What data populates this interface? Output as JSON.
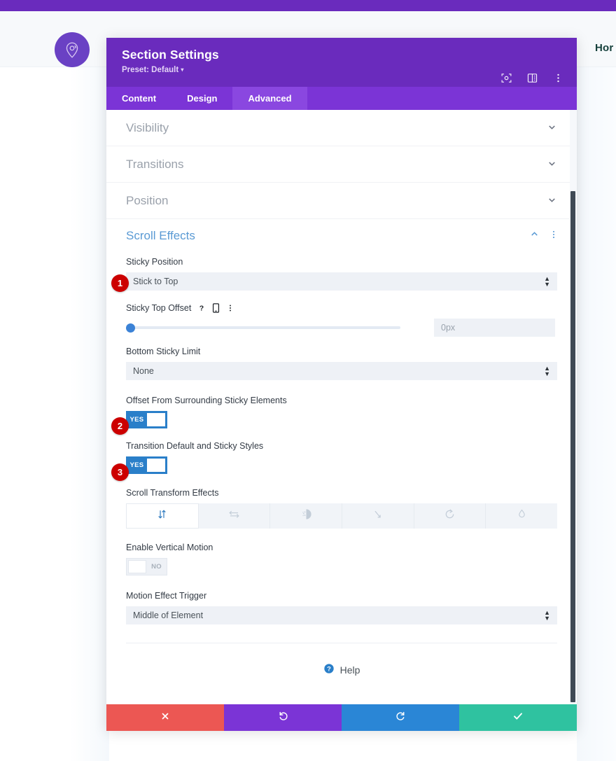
{
  "page": {
    "logo_icon": "map-pin-icon",
    "nav_item_truncated": "Hor"
  },
  "modal": {
    "title": "Section Settings",
    "preset": "Preset: Default",
    "preset_caret": "▾",
    "header_icons": [
      {
        "name": "focus-target-icon"
      },
      {
        "name": "layout-panel-icon"
      },
      {
        "name": "kebab-menu-icon"
      }
    ],
    "tabs": [
      {
        "label": "Content",
        "active": false
      },
      {
        "label": "Design",
        "active": false
      },
      {
        "label": "Advanced",
        "active": true
      }
    ],
    "collapsed_sections": [
      {
        "label": "Visibility",
        "chevron": "chevron-down-icon"
      },
      {
        "label": "Transitions",
        "chevron": "chevron-down-icon"
      },
      {
        "label": "Position",
        "chevron": "chevron-down-icon"
      }
    ],
    "open_section": {
      "label": "Scroll Effects",
      "chevron": "chevron-up-icon",
      "kebab": "kebab-menu-icon"
    },
    "fields": {
      "sticky_position": {
        "label": "Sticky Position",
        "value": "Stick to Top",
        "callout": "1"
      },
      "sticky_top_offset": {
        "label": "Sticky Top Offset",
        "help_icon": "question-mark-icon",
        "responsive_icon": "mobile-device-icon",
        "kebab_icon": "kebab-menu-icon",
        "slider_value": "0px",
        "slider_percent": 0
      },
      "bottom_sticky_limit": {
        "label": "Bottom Sticky Limit",
        "value": "None"
      },
      "offset_surrounding": {
        "label": "Offset From Surrounding Sticky Elements",
        "toggle_state": "YES",
        "callout": "2"
      },
      "transition_styles": {
        "label": "Transition Default and Sticky Styles",
        "toggle_state": "YES",
        "callout": "3"
      },
      "scroll_transform_effects": {
        "label": "Scroll Transform Effects",
        "options": [
          {
            "name": "vertical-motion-icon",
            "active": true
          },
          {
            "name": "horizontal-motion-icon",
            "active": false
          },
          {
            "name": "fade-in-out-icon",
            "active": false
          },
          {
            "name": "scaling-up-down-icon",
            "active": false
          },
          {
            "name": "rotating-icon",
            "active": false
          },
          {
            "name": "blur-icon",
            "active": false
          }
        ]
      },
      "enable_vertical_motion": {
        "label": "Enable Vertical Motion",
        "toggle_state": "NO"
      },
      "motion_effect_trigger": {
        "label": "Motion Effect Trigger",
        "value": "Middle of Element"
      }
    },
    "help": {
      "icon": "help-circle-icon",
      "label": "Help"
    },
    "footer_buttons": [
      {
        "name": "cancel-button",
        "icon": "close-x-icon",
        "color": "#ec5753"
      },
      {
        "name": "undo-button",
        "icon": "undo-arrow-icon",
        "color": "#7b34d6"
      },
      {
        "name": "redo-button",
        "icon": "redo-arrow-icon",
        "color": "#2a86d6"
      },
      {
        "name": "save-button",
        "icon": "checkmark-icon",
        "color": "#2fc2a0"
      }
    ],
    "colors": {
      "header_purple": "#6a2bbd",
      "tabs_purple": "#7b34d6",
      "active_tab_purple": "#8a47e0",
      "section_blue": "#5a9ad4",
      "toggle_on_blue": "#2a7fc9",
      "callout_red": "#cc0000"
    }
  }
}
